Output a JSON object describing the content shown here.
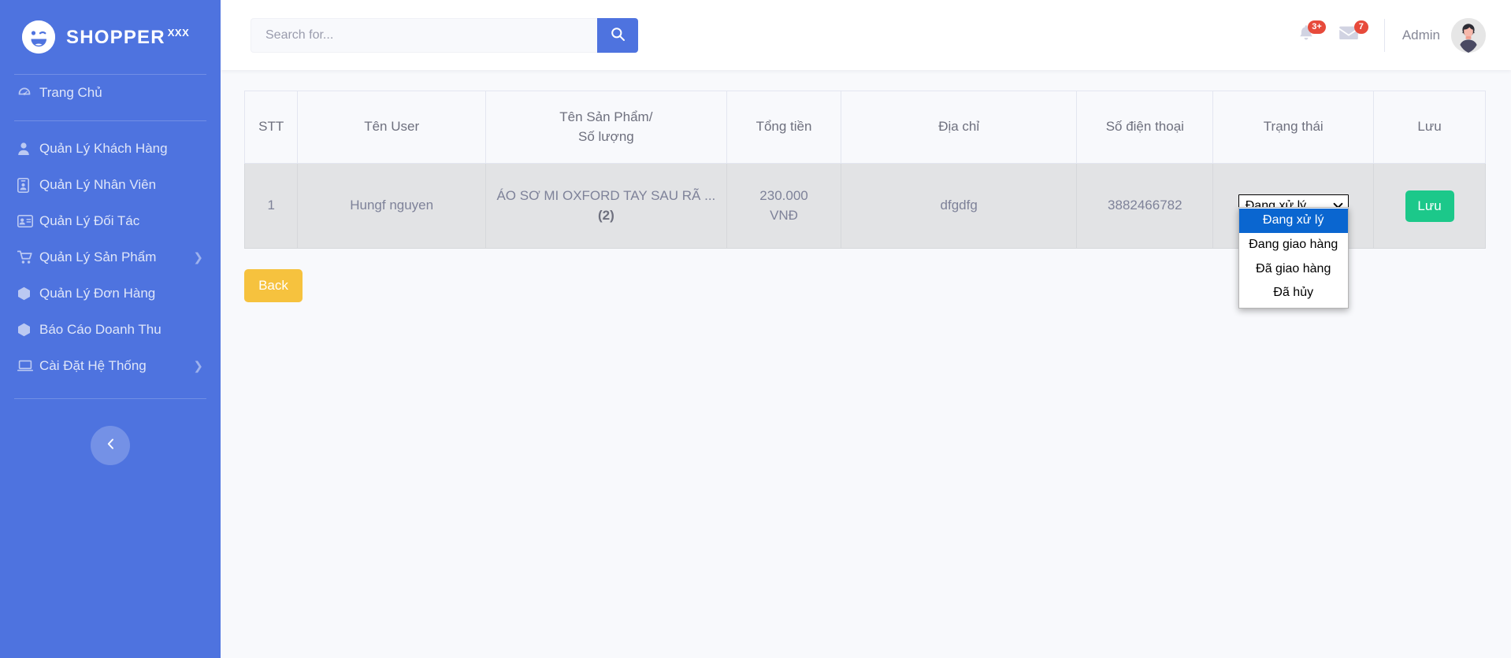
{
  "brand": {
    "name": "SHOPPER",
    "superscript": "XXX",
    "logo_icon": "smiley-wink-icon"
  },
  "sidebar": {
    "accent_color": "#4e73df",
    "items": [
      {
        "label": "Trang Chủ",
        "icon": "dashboard-icon",
        "caret": ""
      },
      {
        "label": "Quản Lý Khách Hàng",
        "icon": "user-icon",
        "caret": ""
      },
      {
        "label": "Quản Lý Nhân Viên",
        "icon": "id-badge-icon",
        "caret": ""
      },
      {
        "label": "Quản Lý Đối Tác",
        "icon": "id-card-icon",
        "caret": ""
      },
      {
        "label": "Quản Lý Sản Phẩm",
        "icon": "cart-icon",
        "caret": "❯"
      },
      {
        "label": "Quản Lý Đơn Hàng",
        "icon": "cube-icon",
        "caret": ""
      },
      {
        "label": "Báo Cáo Doanh Thu",
        "icon": "cube-icon",
        "caret": ""
      },
      {
        "label": "Cài Đặt Hệ Thống",
        "icon": "laptop-icon",
        "caret": "❯"
      }
    ],
    "collapse_icon": "chevron-left-icon"
  },
  "topbar": {
    "search": {
      "placeholder": "Search for...",
      "value": "",
      "button_icon": "search-icon"
    },
    "alerts": {
      "icon": "bell-icon",
      "badge": "3+",
      "badge_color": "#e74a3b"
    },
    "messages": {
      "icon": "envelope-icon",
      "badge": "7",
      "badge_color": "#e74a3b"
    },
    "user": {
      "name": "Admin",
      "avatar_icon": "avatar-icon"
    }
  },
  "table": {
    "columns": [
      {
        "key": "stt",
        "label": "STT"
      },
      {
        "key": "user",
        "label": "Tên User"
      },
      {
        "key": "prod",
        "label_line1": "Tên Sản Phẩm/",
        "label_line2": "Số lượng"
      },
      {
        "key": "total",
        "label": "Tổng tiền"
      },
      {
        "key": "addr",
        "label": "Địa chỉ"
      },
      {
        "key": "phone",
        "label": "Số điện thoại"
      },
      {
        "key": "status",
        "label": "Trạng thái"
      },
      {
        "key": "save",
        "label": "Lưu"
      }
    ],
    "rows": [
      {
        "stt": "1",
        "user": "Hungf nguyen",
        "product_name": "ÁO SƠ MI OXFORD TAY SAU RÃ ...",
        "quantity": "(2)",
        "total_amount": "230.000",
        "total_currency": "VNĐ",
        "address": "dfgdfg",
        "phone": "3882466782",
        "status_selected": "Đang xử lý",
        "save_label": "Lưu"
      }
    ]
  },
  "status_dropdown": {
    "open": true,
    "selected_index": 0,
    "caret_icon": "chevron-down-icon",
    "options": [
      "Đang xử lý",
      "Đang giao hàng",
      "Đã giao hàng",
      "Đã hủy"
    ],
    "highlight_color": "#0a66d0"
  },
  "actions": {
    "back_label": "Back",
    "back_color": "#f6c23e",
    "save_color": "#1cc88a"
  }
}
